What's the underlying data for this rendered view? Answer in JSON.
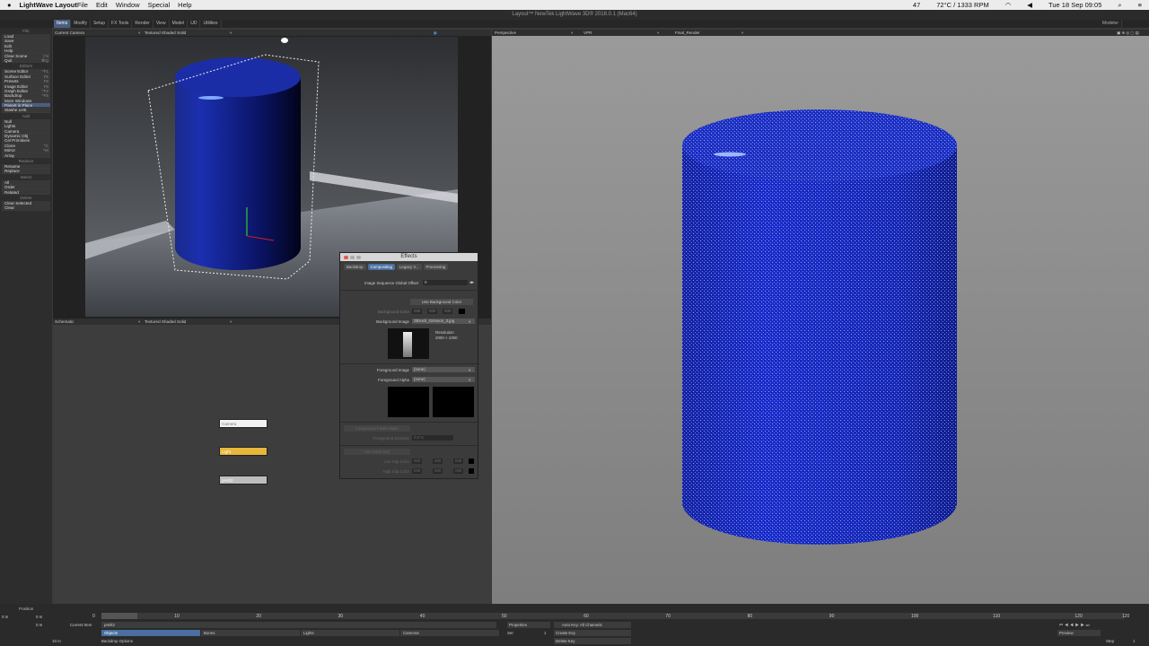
{
  "menubar": {
    "app_name": "LightWave Layout",
    "items": [
      "File",
      "Edit",
      "Window",
      "Special",
      "Help"
    ],
    "status": {
      "temp": "72°C / 1333 RPM",
      "clock": "Tue 18 Sep  09:05",
      "battery_pct": "47"
    }
  },
  "window_title": "Layout™ NewTek LightWave 3D® 2018.0.1 (Mac64)",
  "tabs": {
    "items": [
      "Items",
      "Modify",
      "Setup",
      "FX Tools",
      "Render",
      "View",
      "Model",
      "UD",
      "Utilities"
    ],
    "active": "Items",
    "modeler": "Modeler"
  },
  "toolbar": {
    "file_title": "File",
    "file": [
      {
        "label": "Load"
      },
      {
        "label": "Save"
      },
      {
        "label": "Edit"
      },
      {
        "label": "Help"
      },
      {
        "label": "Clear Scene",
        "sc": "⇧N"
      },
      {
        "label": "Quit",
        "sc": "⌘Q"
      }
    ],
    "editors_title": "Editors",
    "editors": [
      {
        "label": "Scene Editor",
        "sc": "^F1"
      },
      {
        "label": "Surface Editor",
        "sc": "F5"
      },
      {
        "label": "Presets",
        "sc": "F8"
      },
      {
        "label": "Image Editor",
        "sc": "F6"
      },
      {
        "label": "Graph Editor",
        "sc": "^F2"
      },
      {
        "label": "Backdrop",
        "sc": "^F5"
      },
      {
        "label": "More Windows"
      },
      {
        "label": "Parent in Place",
        "hl": true
      },
      {
        "label": "Stashe LHE"
      }
    ],
    "add_title": "Add",
    "add": [
      {
        "label": "Null"
      },
      {
        "label": "Lights"
      },
      {
        "label": "Camera"
      },
      {
        "label": "Dynamic Obj"
      },
      {
        "label": "Cel Primitives"
      },
      {
        "label": "Clone",
        "sc": "^C"
      },
      {
        "label": "Mirror",
        "sc": "^M"
      },
      {
        "label": "Array"
      }
    ],
    "replace_title": "Replace",
    "replace": [
      {
        "label": "Rename"
      },
      {
        "label": "Replace"
      }
    ],
    "select_title": "Select",
    "select": [
      {
        "label": "All"
      },
      {
        "label": "Order"
      },
      {
        "label": "Related"
      }
    ],
    "delete_title": "Delete",
    "delete": [
      {
        "label": "Clear Selected"
      },
      {
        "label": "Clear"
      }
    ]
  },
  "viewport_top": {
    "view": "Current Camera",
    "mode": "Textured Shaded Solid"
  },
  "viewport_bottom": {
    "view": "Schematic",
    "mode": "Textured Shaded Solid"
  },
  "viewport_right": {
    "view": "Perspective",
    "vpr": "VPR",
    "render": "Final_Render"
  },
  "schematic_nodes": {
    "camera": "Camera",
    "light": "Light",
    "object": "prelit2"
  },
  "effects_dialog": {
    "title": "Effects",
    "tabs": [
      "Backdrop",
      "Compositing",
      "Legacy V...",
      "Processing"
    ],
    "active_tab": "Compositing",
    "seq_offset_label": "Image Sequence Global Offset",
    "seq_offset_value": "0",
    "use_bg_color": "Use Background Color",
    "bg_color_label": "Background Color",
    "bg_color_values": [
      "000",
      "000",
      "000"
    ],
    "bg_image_label": "Background Image",
    "bg_image_value": "ZBrush_Grimson_3.jpg",
    "resolution_label": "Resolution",
    "resolution_value": "2000 × 1000",
    "fg_image_label": "Foreground Image",
    "fg_image_value": "(none)",
    "fg_alpha_label": "Foreground Alpha",
    "fg_alpha_value": "(none)",
    "fg_key_label": "Foreground Fader Alpha",
    "dissolve_label": "Foreground Dissolve",
    "dissolve_value": "0.0 %",
    "key_label": "Use Color Key",
    "low_color_label": "Low Clip Color",
    "low_values": [
      "000",
      "000",
      "000"
    ],
    "high_color_label": "High Clip Color",
    "high_values": [
      "000",
      "000",
      "000"
    ]
  },
  "timeline": {
    "position_label": "Position",
    "ticks": [
      "0",
      "10",
      "20",
      "30",
      "40",
      "50",
      "60",
      "70",
      "80",
      "90",
      "100",
      "110",
      "120",
      "120"
    ],
    "frame_start": "0",
    "current_item_label": "Current Item",
    "current_item": "prelit2",
    "properties": "Properties",
    "set_label": "Set",
    "set_value": "1",
    "autokey": "Auto Key: All Channels",
    "create_key": "Create Key",
    "delete_key": "Delete Key",
    "objects": "Objects",
    "bones": "Bones",
    "lights": "Lights",
    "cameras": "Cameras",
    "backdrop_options": "Backdrop Options",
    "preview": "Preview",
    "step_label": "Step",
    "step_value": "1",
    "units": [
      "0 m",
      "0 m",
      "10 m"
    ]
  }
}
